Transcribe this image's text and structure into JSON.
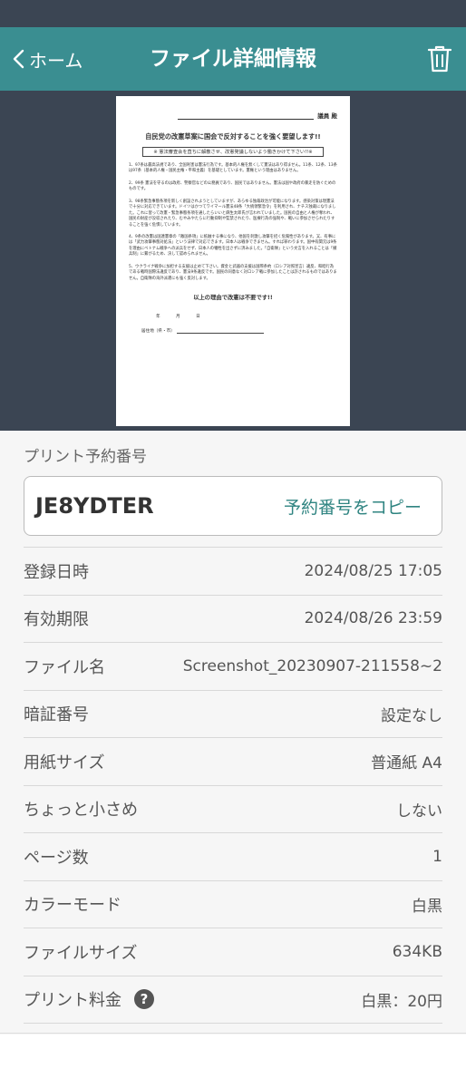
{
  "header": {
    "back_label": "ホーム",
    "title": "ファイル詳細情報",
    "back_icon": "chevron-left-icon",
    "delete_icon": "trash-icon"
  },
  "preview": {
    "addressee": "議員 殿",
    "title": "自民党の改憲草案に国会で反対することを強く要望します!!",
    "subtitle": "※ 憲法審査会を直ちに解散させ、改憲発議しないよう働きかけて下さい!!※",
    "paragraphs": [
      "1、97条は最高法規であり、全国利害は憲法行為です。基本的人権を無くして憲法はあり得ません。11条、12条、13条は97条（基本的人権・国民主権・平和主義）を基礎としています。憲権という理由はありません。",
      "2、99条 憲法を守るのは政府、警察官などの公務員であり、国民ではありません。憲法は国や政府の暴走を防ぐためのものです。",
      "3、98条緊急事態条項を新しく創設されようとしていますが、あらゆる独裁政治が可能になります。感染対策は現憲法で十分に対応できています。ドイツはかつてワイマール憲法48条「大統領緊急令」を利用され、ナチス独裁になりました。これに習って改憲・緊急事態条項を通したらいいと麻生太郎氏が言われていました。国民の自由と人権が奪われ、国民の財産が没収されたり、むやみやたらに行動抑制や監禁されたり、医療行為の強制や、戦いに参加させられたりすることを強く危惧しています。",
      "4、9条の改憲は国連憲章の「敵国条項」に抵触する事になり、他国を刺激し攻撃を招く危険性があります。又、有事には「武力攻撃事態対処法」という法律で対応できます。日本人は戦争できません。すれば罪わります。国中有関元は9条を理由にベトナム戦争への派兵をせず、日本人の犠牲を出さずに済みました。「自衛隊」という文言を入れることは「撤兵制」に繋がるため、決して認められません。",
      "5、ウクライナ戦争に加担する支援は止めて下さい。資金と武器の支援は国際条約（ロシア対照宣言）違反、和睦行為である戦時国際法違反であり、憲法9条違反です。国民の同意なく対ロシア戦に参加したことは許されるものではありません。自衛隊の海外派遣にも強く反対します。"
    ],
    "conclusion": "以上の理由で改憲は不要です!!",
    "footer_date": "年 月 日",
    "footer_address": "居住地（県・市）"
  },
  "details": {
    "reservation_label": "プリント予約番号",
    "reservation_number": "JE8YDTER",
    "copy_label": "予約番号をコピー",
    "rows": [
      {
        "label": "登録日時",
        "value": "2024/08/25 17:05"
      },
      {
        "label": "有効期限",
        "value": "2024/08/26 23:59"
      },
      {
        "label": "ファイル名",
        "value": "Screenshot_20230907-211558~2"
      },
      {
        "label": "暗証番号",
        "value": "設定なし"
      },
      {
        "label": "用紙サイズ",
        "value": "普通紙 A4"
      },
      {
        "label": "ちょっと小さめ",
        "value": "しない"
      },
      {
        "label": "ページ数",
        "value": "1"
      },
      {
        "label": "カラーモード",
        "value": "白黒"
      },
      {
        "label": "ファイルサイズ",
        "value": "634KB"
      },
      {
        "label": "プリント料金",
        "value": "白黒：20円",
        "help_icon": "?"
      }
    ]
  },
  "colors": {
    "app_bar": "#3a8e91",
    "status_bar": "#3b4553",
    "accent_text": "#2f8481"
  }
}
